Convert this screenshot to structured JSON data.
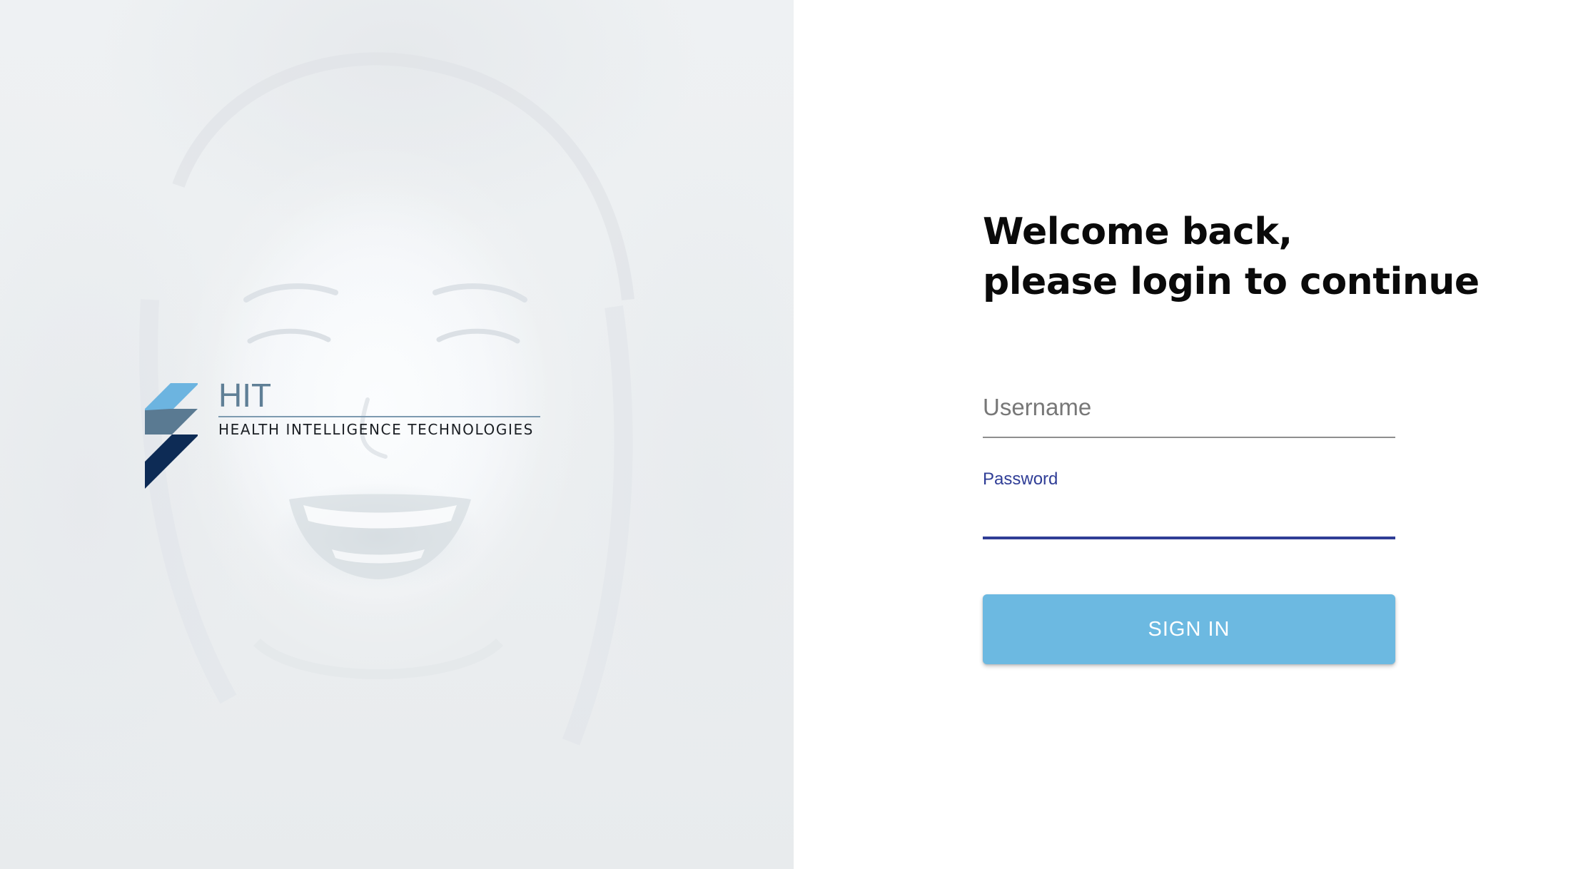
{
  "brand": {
    "logo_title": "HIT",
    "logo_subtitle": "HEALTH INTELLIGENCE TECHNOLOGIES",
    "colors": {
      "mark_light": "#6cb4e0",
      "mark_mid": "#5a7a92",
      "mark_dark": "#0d2b55",
      "title": "#5f7f96"
    }
  },
  "login": {
    "heading_line1": "Welcome back,",
    "heading_line2": "please login to continue",
    "username": {
      "placeholder": "Username",
      "value": ""
    },
    "password": {
      "label": "Password",
      "value": ""
    },
    "submit_label": "SIGN IN"
  },
  "theme": {
    "accent": "#2f3d96",
    "button": "#6cb9e1"
  }
}
